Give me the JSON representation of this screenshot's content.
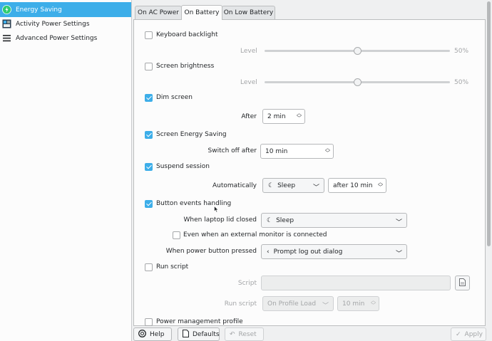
{
  "sidebar": {
    "items": [
      {
        "label": "Energy Saving",
        "icon": "energy-leaf-icon",
        "active": true
      },
      {
        "label": "Activity Power Settings",
        "icon": "activity-icon",
        "active": false
      },
      {
        "label": "Advanced Power Settings",
        "icon": "menu-lines-icon",
        "active": false
      }
    ]
  },
  "tabs": [
    {
      "label": "On AC Power",
      "active": false
    },
    {
      "label": "On Battery",
      "active": true
    },
    {
      "label": "On Low Battery",
      "active": false
    }
  ],
  "form": {
    "keyboard_backlight": {
      "label": "Keyboard backlight",
      "checked": false,
      "level_label": "Level",
      "level_value": "50%",
      "level": 0.5
    },
    "screen_brightness": {
      "label": "Screen brightness",
      "checked": false,
      "level_label": "Level",
      "level_value": "50%",
      "level": 0.5
    },
    "dim_screen": {
      "label": "Dim screen",
      "checked": true,
      "after_label": "After",
      "after_value": "2 min"
    },
    "screen_energy_saving": {
      "label": "Screen Energy Saving",
      "checked": true,
      "switch_off_label": "Switch off after",
      "switch_off_value": "10 min"
    },
    "suspend_session": {
      "label": "Suspend session",
      "checked": true,
      "automatically_label": "Automatically",
      "action_value": "Sleep",
      "after_value": "after 10 min"
    },
    "button_events": {
      "label": "Button events handling",
      "checked": true,
      "lid_label": "When laptop lid closed",
      "lid_value": "Sleep",
      "external_monitor_label": "Even when an external monitor is connected",
      "external_monitor_checked": false,
      "power_button_label": "When power button pressed",
      "power_button_value": "Prompt log out dialog"
    },
    "run_script": {
      "label": "Run script",
      "checked": false,
      "script_label": "Script",
      "script_value": "",
      "run_script_label": "Run script",
      "run_on_value": "On Profile Load",
      "run_after_value": "10 min"
    },
    "power_profile": {
      "label": "Power management profile",
      "checked": false
    }
  },
  "footer": {
    "help": "Help",
    "defaults": "Defaults",
    "reset": "Reset",
    "apply": "Apply"
  },
  "colors": {
    "accent": "#3daee9",
    "background": "#eff0f1",
    "panel": "#fcfcfc"
  }
}
